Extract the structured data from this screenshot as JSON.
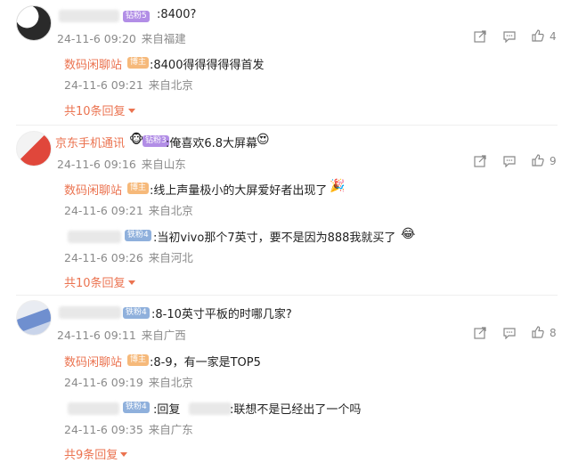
{
  "comments": [
    {
      "user_badge": "钻粉5",
      "text": ":8400?",
      "time": "24-11-6 09:20",
      "location": "来自福建",
      "like_count": "4",
      "replies": [
        {
          "name": "数码闲聊站",
          "badge": "博主",
          "text": ":8400得得得得得首发",
          "time": "24-11-6 09:21",
          "location": "来自北京"
        }
      ],
      "more_replies": "共10条回复"
    },
    {
      "user_name": "京东手机通讯",
      "user_badge": "钻粉3",
      "text": ":俺喜欢6.8大屏幕",
      "time": "24-11-6 09:16",
      "location": "来自山东",
      "like_count": "9",
      "replies": [
        {
          "name": "数码闲聊站",
          "badge": "博主",
          "text": ":线上声量极小的大屏爱好者出现了",
          "time": "24-11-6 09:21",
          "location": "来自北京"
        },
        {
          "badge": "铁粉4",
          "text": ":当初vivo那个7英寸，要不是因为888我就买了",
          "time": "24-11-6 09:26",
          "location": "来自河北"
        }
      ],
      "more_replies": "共10条回复"
    },
    {
      "user_badge": "铁粉4",
      "text": ":8-10英寸平板的时哪几家?",
      "time": "24-11-6 09:11",
      "location": "来自广西",
      "like_count": "8",
      "replies": [
        {
          "name": "数码闲聊站",
          "badge": "博主",
          "text": ":8-9，有一家是TOP5",
          "time": "24-11-6 09:19",
          "location": "来自北京"
        },
        {
          "badge": "铁粉4",
          "text_prefix": ":回复",
          "text": ":联想不是已经出了一个吗",
          "time": "24-11-6 09:35",
          "location": "来自广东"
        }
      ],
      "more_replies": "共9条回复"
    }
  ],
  "icons": {
    "share": "share-icon",
    "comment": "comment-icon",
    "like": "thumbs-up-icon"
  },
  "colors": {
    "accent": "#eb7350",
    "meta": "#8a8a8a"
  }
}
